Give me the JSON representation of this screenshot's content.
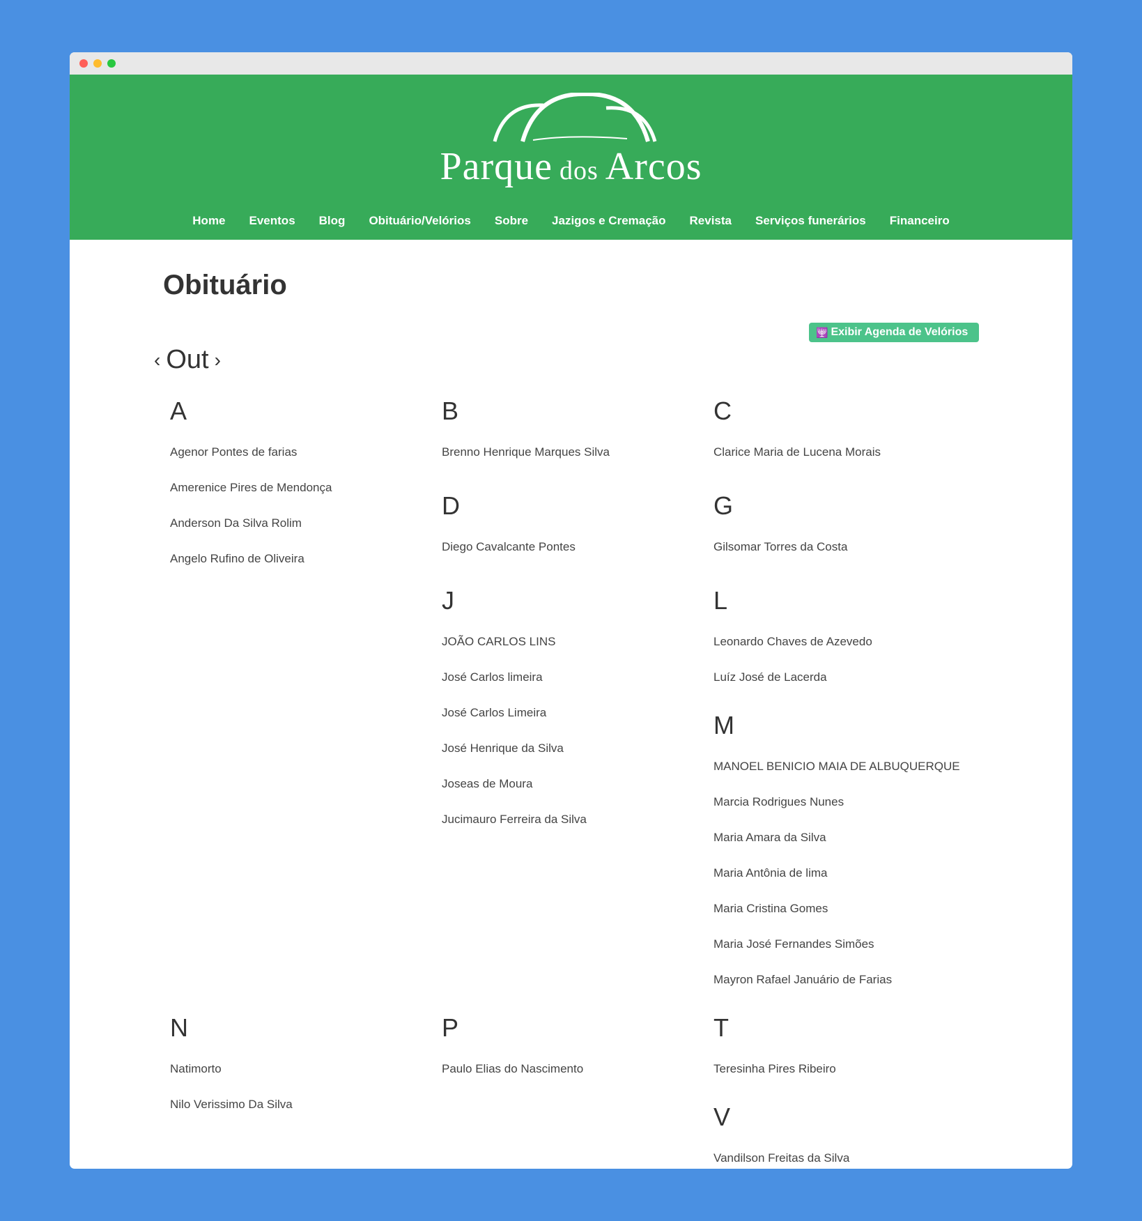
{
  "logo": {
    "text_main_1": "Parque",
    "text_small": "dos",
    "text_main_2": "Arcos"
  },
  "nav": [
    "Home",
    "Eventos",
    "Blog",
    "Obituário/Velórios",
    "Sobre",
    "Jazigos e Cremação",
    "Revista",
    "Serviços funerários",
    "Financeiro"
  ],
  "page_title": "Obituário",
  "agenda_button": {
    "icon": "candles-icon",
    "label": "Exibir Agenda de Velórios"
  },
  "month_nav": {
    "prev": "‹",
    "month": "Out",
    "next": "›"
  },
  "groups": {
    "A": {
      "letter": "A",
      "names": [
        "Agenor Pontes de farias",
        "Amerenice Pires de Mendonça",
        "Anderson Da Silva Rolim",
        "Angelo Rufino de Oliveira"
      ]
    },
    "B": {
      "letter": "B",
      "names": [
        "Brenno Henrique Marques Silva"
      ]
    },
    "C": {
      "letter": "C",
      "names": [
        "Clarice Maria de Lucena Morais"
      ]
    },
    "D": {
      "letter": "D",
      "names": [
        "Diego Cavalcante Pontes"
      ]
    },
    "G": {
      "letter": "G",
      "names": [
        "Gilsomar Torres da Costa"
      ]
    },
    "J": {
      "letter": "J",
      "names": [
        "JOÃO CARLOS LINS",
        "José Carlos limeira",
        "José Carlos Limeira",
        "José Henrique da Silva",
        "Joseas de Moura",
        "Jucimauro Ferreira da Silva"
      ]
    },
    "L": {
      "letter": "L",
      "names": [
        "Leonardo Chaves de Azevedo",
        "Luíz José de Lacerda"
      ]
    },
    "M": {
      "letter": "M",
      "names": [
        "MANOEL BENICIO MAIA DE ALBUQUERQUE",
        "Marcia Rodrigues Nunes",
        "Maria Amara da Silva",
        "Maria Antônia de lima",
        "Maria Cristina Gomes",
        "Maria José Fernandes Simões",
        "Mayron Rafael Januário de Farias"
      ]
    },
    "N": {
      "letter": "N",
      "names": [
        "Natimorto",
        "Nilo Verissimo Da Silva"
      ]
    },
    "P": {
      "letter": "P",
      "names": [
        "Paulo Elias do Nascimento"
      ]
    },
    "T": {
      "letter": "T",
      "names": [
        "Teresinha Pires Ribeiro"
      ]
    },
    "V": {
      "letter": "V",
      "names": [
        "Vandilson Freitas da Silva"
      ]
    }
  },
  "colors": {
    "page_bg": "#4A90E2",
    "header_green": "#37AB59",
    "button_green": "#4CC38A"
  }
}
